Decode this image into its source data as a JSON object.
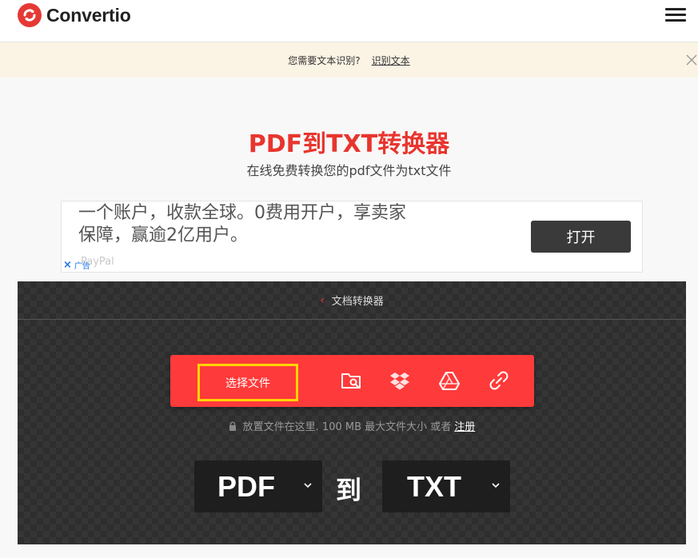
{
  "header": {
    "logo_text": "Convertio",
    "brand_color": "#e53935",
    "menu_icon": "hamburger-menu-icon"
  },
  "notice": {
    "text": "您需要文本识别?",
    "link_text": "识别文本",
    "close_icon": "close-icon",
    "background": "#fbf3e4"
  },
  "page": {
    "title": "PDF到TXT转换器",
    "subtitle": "在线免费转换您的pdf文件为txt文件",
    "title_color": "#e8352e"
  },
  "ad": {
    "line1": "一个账户，收款全球。0费用开户，享卖家",
    "line2": "保障，赢逾2亿用户。",
    "button_label": "打开",
    "brand_text": "PayPal",
    "ad_label": "广告",
    "ad_close": "×"
  },
  "converter": {
    "breadcrumb": "文档转换器",
    "back_icon": "chevron-left-icon",
    "choose_label": "选择文件",
    "upload_color": "#ff3a3a",
    "sources": [
      {
        "name": "folder-search-icon"
      },
      {
        "name": "dropbox-icon"
      },
      {
        "name": "google-drive-icon"
      },
      {
        "name": "link-icon"
      }
    ],
    "drop_hint": "放置文件在这里. 100 MB 最大文件大小 或者",
    "signup_link": "注册",
    "from_format": "PDF",
    "to_word": "到",
    "to_format": "TXT"
  }
}
